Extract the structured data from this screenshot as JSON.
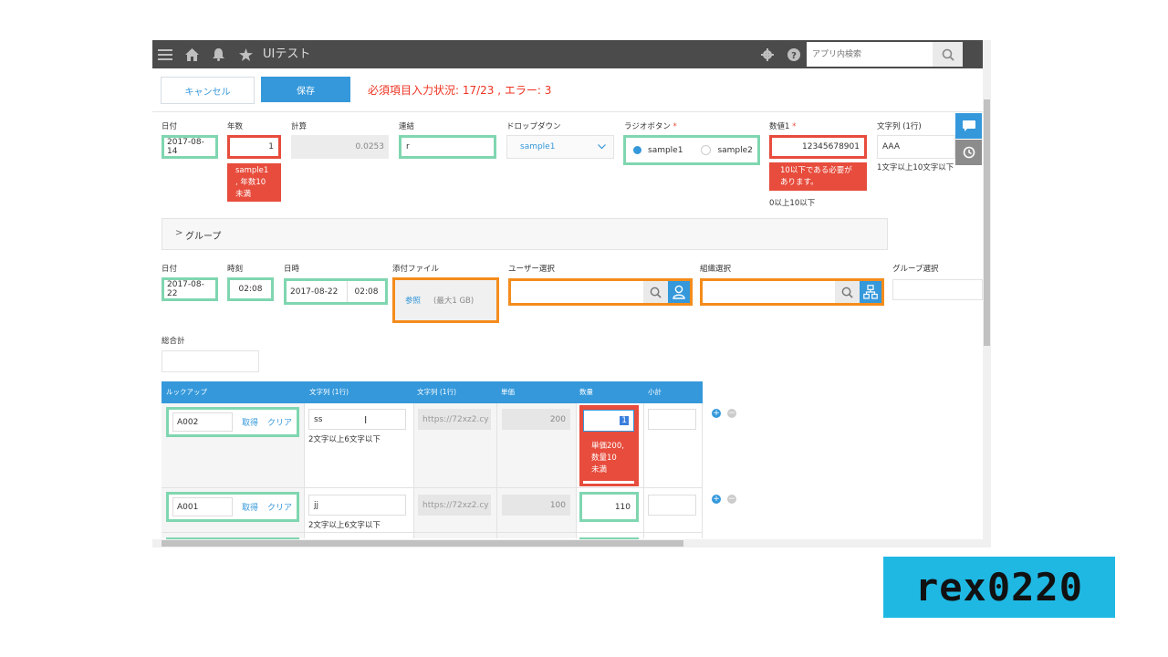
{
  "app": {
    "title": "UIテスト",
    "search_placeholder": "アプリ内検索"
  },
  "toolbar": {
    "cancel_label": "キャンセル",
    "save_label": "保存",
    "status": "必須項目入力状況: 17/23 , エラー: 3"
  },
  "row1": {
    "date_label": "日付",
    "date_value": "2017-08-14",
    "years_label": "年数",
    "years_value": "1",
    "years_error": [
      "sample1",
      ", 年数10",
      "未満"
    ],
    "calc_label": "計算",
    "calc_value": "0.0253",
    "link_label": "連結",
    "link_value": "r",
    "dropdown_label": "ドロップダウン",
    "dropdown_value": "sample1",
    "radio_label": "ラジオボタン",
    "radio_opt1": "sample1",
    "radio_opt2": "sample2",
    "num1_label": "数値1",
    "num1_value": "12345678901",
    "num1_error": [
      "10以下である必要が",
      "あります。"
    ],
    "num1_hint": "0以上10以下",
    "str_label": "文字列 (1行)",
    "str_value": "AAA",
    "str_hint": "1文字以上10文字以下",
    "required_mark": "*"
  },
  "group": {
    "label": "グループ"
  },
  "row2": {
    "date_label": "日付",
    "date_value": "2017-08-22",
    "time_label": "時刻",
    "time_value": "02:08",
    "datetime_label": "日時",
    "datetime_date": "2017-08-22",
    "datetime_time": "02:08",
    "attach_label": "添付ファイル",
    "attach_browse": "参照",
    "attach_limit": "(最大1 GB)",
    "user_label": "ユーザー選択",
    "org_label": "組織選択",
    "group_label": "グループ選択"
  },
  "total": {
    "label": "総合計"
  },
  "table": {
    "headers": [
      "ルックアップ",
      "文字列 (1行)",
      "文字列 (1行)",
      "単価",
      "数量",
      "小計"
    ],
    "get_label": "取得",
    "clear_label": "クリア",
    "rows": [
      {
        "lookup": "A002",
        "str1": "ss",
        "str1_hint": "2文字以上6文字以下",
        "str2": "https://72xz2.cy",
        "price": "200",
        "qty": "1",
        "qty_error": [
          "単価200,",
          "数量10",
          "未満"
        ]
      },
      {
        "lookup": "A001",
        "str1": "jj",
        "str1_hint": "2文字以上6文字以下",
        "str2": "https://72xz2.cy",
        "price": "100",
        "qty": "110"
      }
    ]
  },
  "watermark": {
    "text": "rex0220"
  },
  "colors": {
    "accent": "#3498db",
    "error": "#e74c3c",
    "valid": "#7fd6b0",
    "warning": "#f48c1c",
    "header": "#4b4b4b"
  }
}
